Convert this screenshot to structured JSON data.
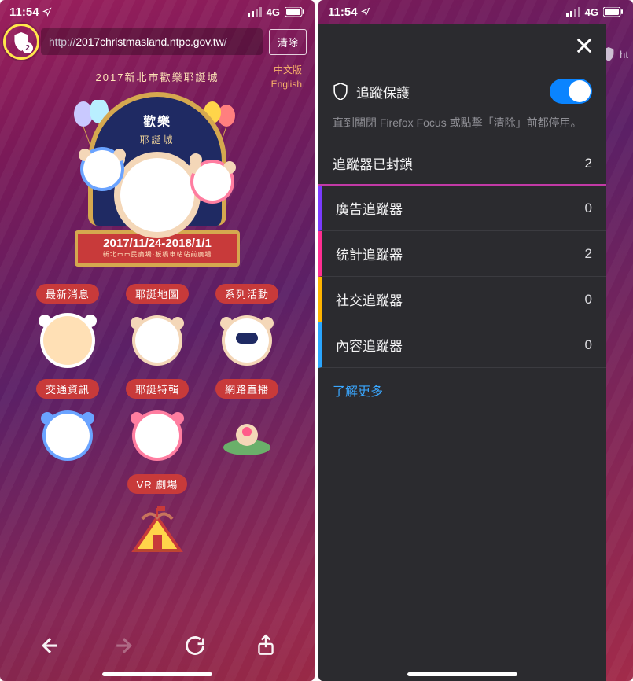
{
  "status": {
    "time": "11:54",
    "network": "4G"
  },
  "left": {
    "url": {
      "scheme": "http://",
      "host": "2017christmasland.ntpc.gov.tw",
      "path": "/"
    },
    "shield_count": "2",
    "clear_label": "清除",
    "langs": {
      "zh": "中文版",
      "en": "English"
    },
    "hero": {
      "site_title": "2017新北市歡樂耶誕城",
      "poster_title": "歡樂",
      "poster_subtitle": "耶誕城",
      "date": "2017/11/24-2018/1/1",
      "venue": "新北市市民廣場·板橋車站站前廣場"
    },
    "menu": [
      {
        "label": "最新消息"
      },
      {
        "label": "耶誕地圖"
      },
      {
        "label": "系列活動"
      },
      {
        "label": "交通資訊"
      },
      {
        "label": "耶誕特輯"
      },
      {
        "label": "網路直播"
      },
      {
        "label": "VR 劇場"
      }
    ]
  },
  "right": {
    "peek_url": "ht",
    "protection": {
      "title": "追蹤保護",
      "enabled": true
    },
    "note": "直到關閉 Firefox Focus 或點擊「清除」前都停用。",
    "blocked": {
      "label": "追蹤器已封鎖",
      "count": "2"
    },
    "trackers": [
      {
        "label": "廣告追蹤器",
        "count": "0",
        "color": "c-purple"
      },
      {
        "label": "統計追蹤器",
        "count": "2",
        "color": "c-pink"
      },
      {
        "label": "社交追蹤器",
        "count": "0",
        "color": "c-yellow"
      },
      {
        "label": "內容追蹤器",
        "count": "0",
        "color": "c-blue"
      }
    ],
    "learn_more": "了解更多"
  }
}
